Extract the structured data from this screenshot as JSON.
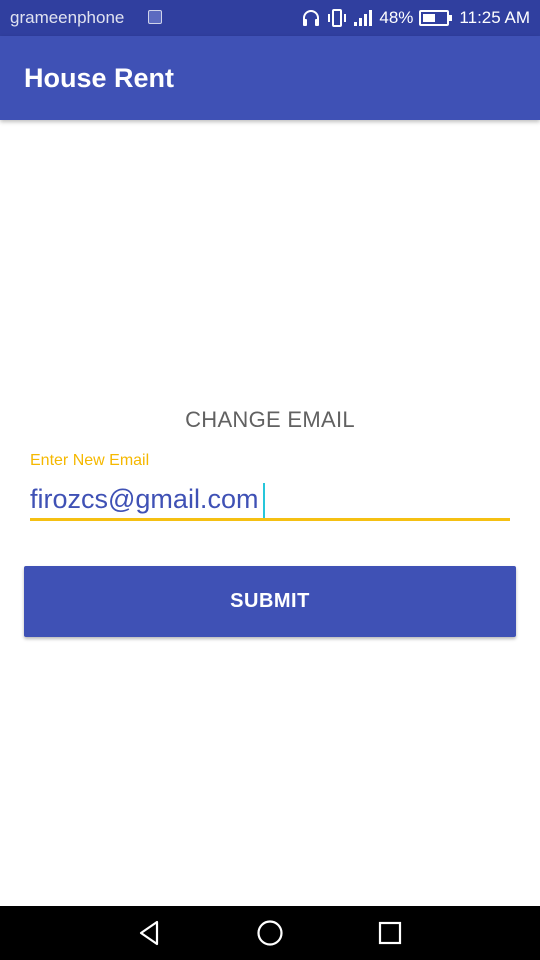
{
  "status_bar": {
    "carrier": "grameenphone",
    "battery": "48%",
    "time": "11:25 AM",
    "icons": [
      "image-icon",
      "headphones-icon",
      "vibrate-icon",
      "signal-icon",
      "battery-icon"
    ]
  },
  "app_bar": {
    "title": "House Rent"
  },
  "form": {
    "heading": "CHANGE EMAIL",
    "email_label": "Enter New Email",
    "email_value": "firozcs@gmail.com",
    "submit_label": "SUBMIT"
  },
  "nav_bar": {
    "icons": [
      "back-icon",
      "home-icon",
      "recents-icon"
    ]
  },
  "colors": {
    "status_bar": "#303F9F",
    "primary": "#3F51B5",
    "accent": "#F5C013",
    "caret": "#26C6DA"
  }
}
